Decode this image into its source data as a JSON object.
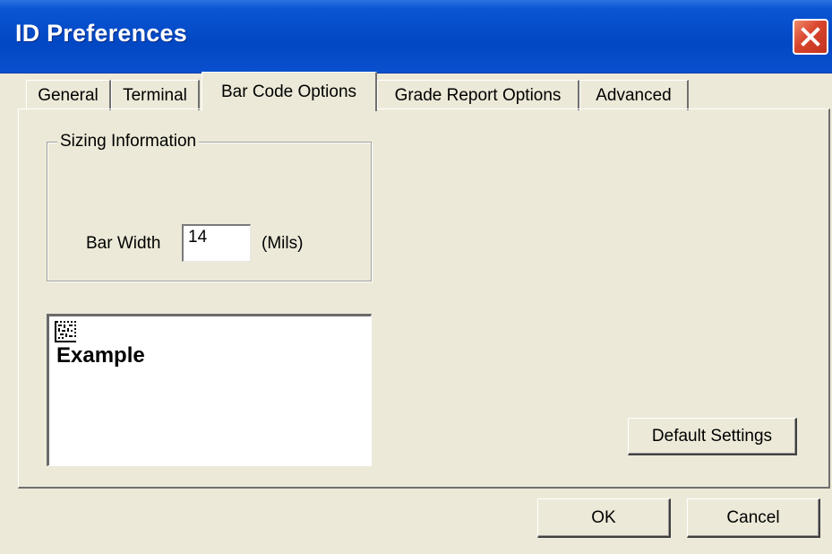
{
  "window": {
    "title": "ID Preferences",
    "close_icon": "close-icon"
  },
  "tabs": [
    {
      "label": "General",
      "active": false
    },
    {
      "label": "Terminal",
      "active": false
    },
    {
      "label": "Bar Code Options",
      "active": true
    },
    {
      "label": "Grade Report Options",
      "active": false
    },
    {
      "label": "Advanced",
      "active": false
    }
  ],
  "sizing": {
    "group_label": "Sizing Information",
    "bar_width_label": "Bar Width",
    "bar_width_value": "14",
    "unit_label": "(Mils)"
  },
  "preview": {
    "barcode_icon": "datamatrix-barcode-icon",
    "example_text": "Example"
  },
  "buttons": {
    "default_settings": "Default Settings",
    "ok": "OK",
    "cancel": "Cancel"
  },
  "colors": {
    "titlebar": "#0247c3",
    "face": "#ece9d8",
    "close": "#d8442c"
  }
}
